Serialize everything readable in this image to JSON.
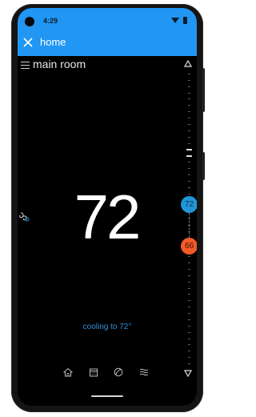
{
  "status_bar": {
    "time": "4:29"
  },
  "app_bar": {
    "title": "home",
    "close_icon": "close-icon"
  },
  "room": {
    "name": "main room"
  },
  "thermostat": {
    "current_temperature": "72",
    "cool_setpoint": "72",
    "heat_setpoint": "66",
    "status": "cooling to 72°",
    "mode_icon": "fan-icon"
  },
  "bottom_nav": {
    "items": [
      "home-icon",
      "calendar-icon",
      "leaf-icon",
      "waves-icon"
    ]
  },
  "colors": {
    "app_bar": "#2196f3",
    "cool": "#2196d6",
    "heat": "#f25a28",
    "status_text": "#2f8fd8",
    "background": "#000000"
  }
}
